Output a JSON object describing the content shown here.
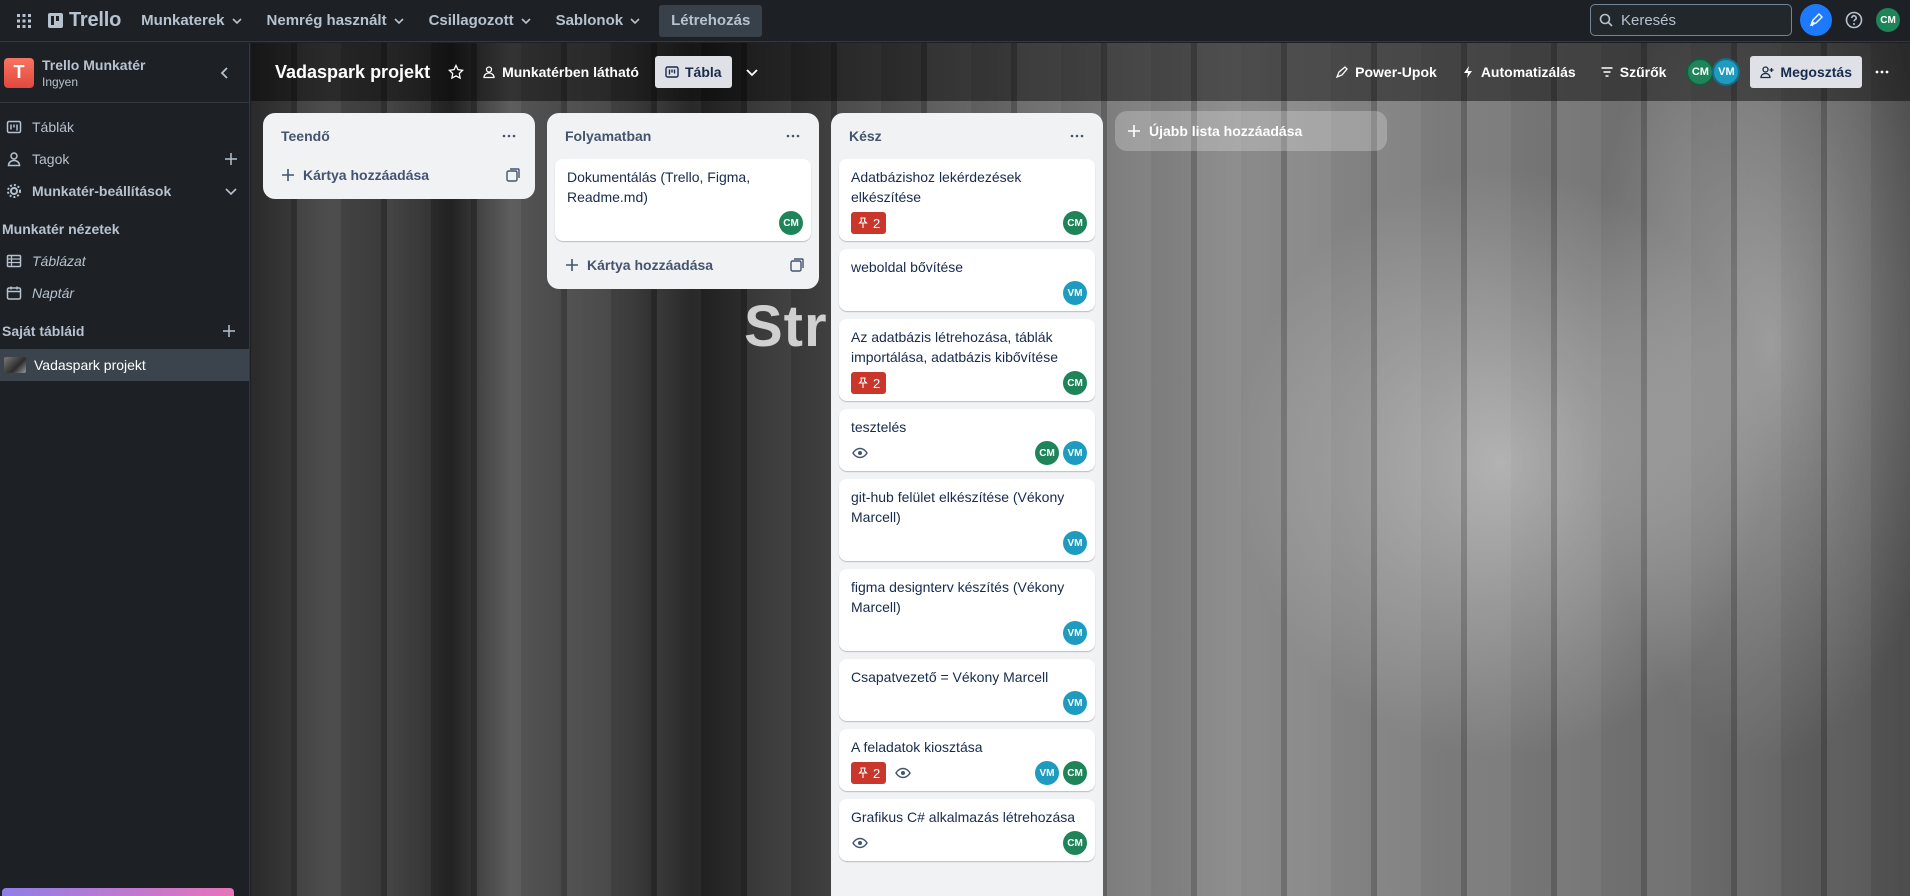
{
  "topbar": {
    "logo": "Trello",
    "nav": [
      {
        "label": "Munkaterek"
      },
      {
        "label": "Nemrég használt"
      },
      {
        "label": "Csillagozott"
      },
      {
        "label": "Sablonok"
      }
    ],
    "create_label": "Létrehozás",
    "search_placeholder": "Keresés",
    "user_initials": "CM"
  },
  "sidebar": {
    "workspace_name": "Trello Munkatér",
    "workspace_plan": "Ingyen",
    "workspace_letter": "T",
    "items": [
      {
        "label": "Táblák"
      },
      {
        "label": "Tagok"
      },
      {
        "label": "Munkatér-beállítások"
      }
    ],
    "views_section": "Munkatér nézetek",
    "views": [
      {
        "label": "Táblázat"
      },
      {
        "label": "Naptár"
      }
    ],
    "boards_section": "Saját tábláid",
    "boards": [
      {
        "label": "Vadaspark projekt"
      }
    ]
  },
  "board": {
    "title": "Vadaspark projekt",
    "visibility": "Munkatérben látható",
    "view_label": "Tábla",
    "power_ups": "Power-Upok",
    "automation": "Automatizálás",
    "filters": "Szűrők",
    "share": "Megosztás",
    "members": [
      "CM",
      "VM"
    ],
    "add_list": "Újabb lista hozzáadása",
    "background_text": "Str"
  },
  "lists": [
    {
      "title": "Teendő",
      "add_card": "Kártya hozzáadása",
      "cards": []
    },
    {
      "title": "Folyamatban",
      "add_card": "Kártya hozzáadása",
      "cards": [
        {
          "title": "Dokumentálás (Trello, Figma, Readme.md)",
          "badge": null,
          "watch": false,
          "members": [
            "CM"
          ]
        }
      ]
    },
    {
      "title": "Kész",
      "cards": [
        {
          "title": "Adatbázishoz lekérdezések elkészítése",
          "badge": "2",
          "watch": false,
          "members": [
            "CM"
          ]
        },
        {
          "title": "weboldal bővítése",
          "badge": null,
          "watch": false,
          "members": [
            "VM"
          ]
        },
        {
          "title": "Az adatbázis létrehozása, táblák importálása, adatbázis kibővítése",
          "badge": "2",
          "watch": false,
          "members": [
            "CM"
          ]
        },
        {
          "title": "tesztelés",
          "badge": null,
          "watch": true,
          "members": [
            "CM",
            "VM"
          ]
        },
        {
          "title": "git-hub felület elkészítése (Vékony Marcell)",
          "badge": null,
          "watch": false,
          "members": [
            "VM"
          ]
        },
        {
          "title": "figma designterv készítés (Vékony Marcell)",
          "badge": null,
          "watch": false,
          "members": [
            "VM"
          ]
        },
        {
          "title": "Csapatvezető = Vékony Marcell",
          "badge": null,
          "watch": false,
          "members": [
            "VM"
          ]
        },
        {
          "title": "A feladatok kiosztása",
          "badge": "2",
          "watch": true,
          "members": [
            "VM",
            "CM"
          ]
        },
        {
          "title": "Grafikus C# alkalmazás létrehozása",
          "badge": null,
          "watch": true,
          "members": [
            "CM"
          ]
        }
      ]
    }
  ]
}
